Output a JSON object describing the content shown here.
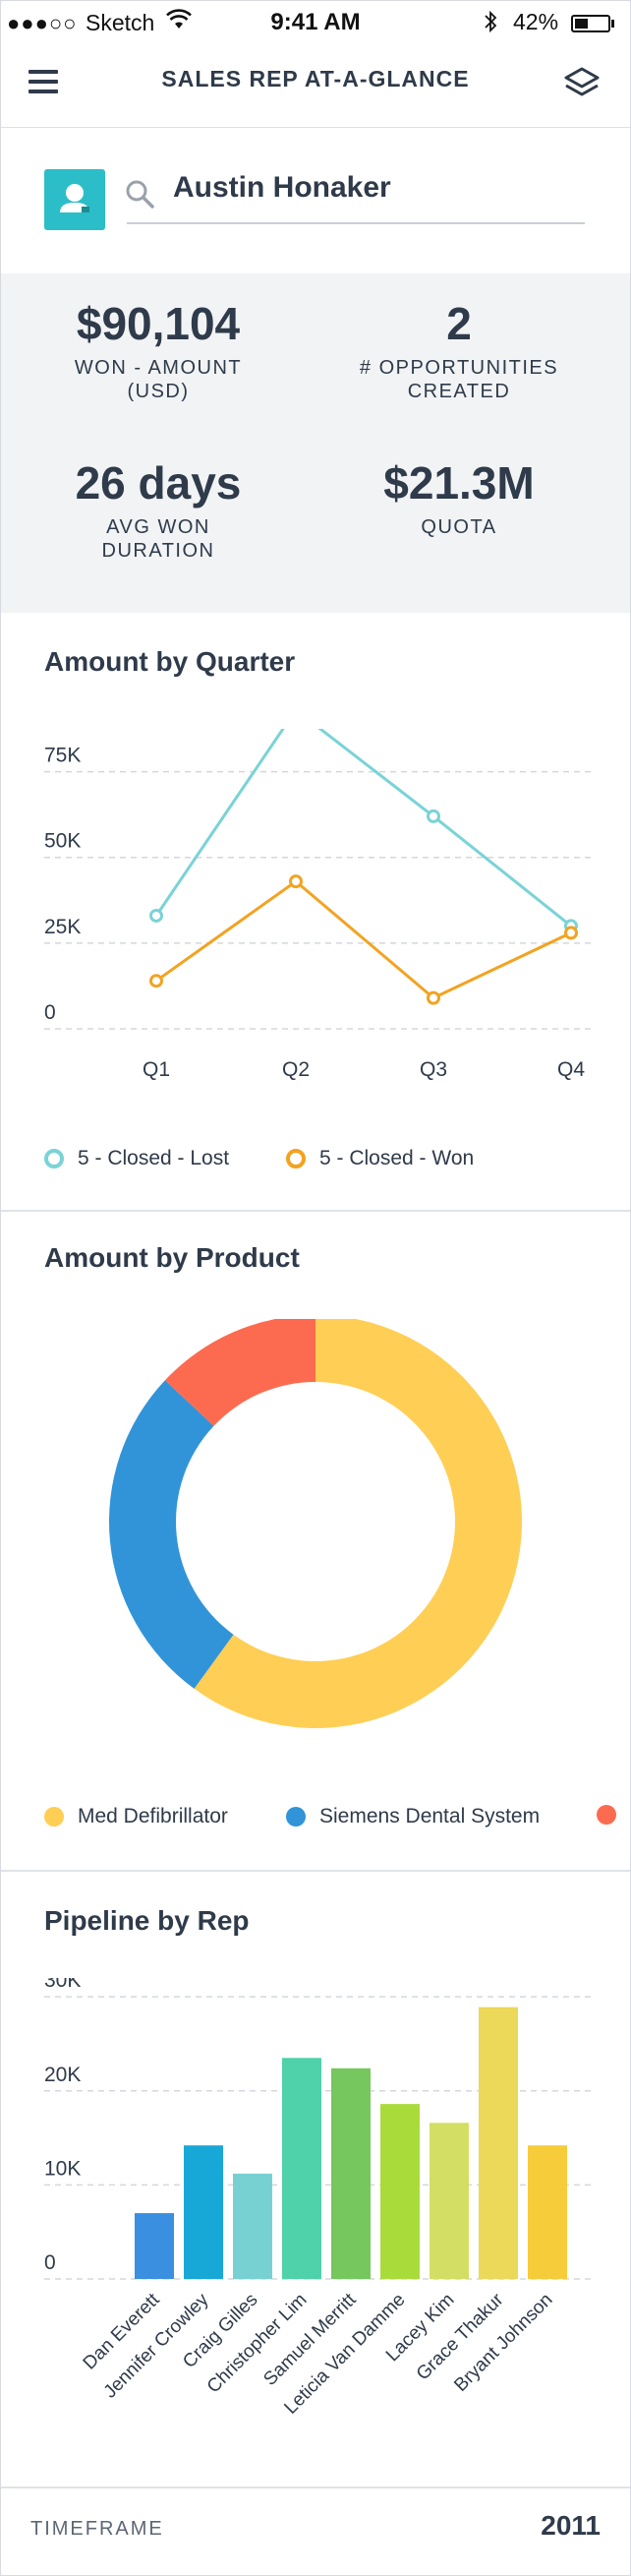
{
  "status_bar": {
    "signal": "●●●○○",
    "carrier": "Sketch",
    "time": "9:41 AM",
    "battery": "42%",
    "battery_level": 0.42
  },
  "nav": {
    "title": "SALES REP AT-A-GLANCE",
    "menu_icon": "hamburger-menu-icon",
    "layers_icon": "layers-icon"
  },
  "search": {
    "name": "Austin Honaker"
  },
  "metrics": [
    {
      "value": "$90,104",
      "label_line1": "WON - AMOUNT",
      "label_line2": "(USD)"
    },
    {
      "value": "2",
      "label_line1": "# OPPORTUNITIES",
      "label_line2": "CREATED"
    },
    {
      "value": "26 days",
      "label_line1": "AVG WON",
      "label_line2": "DURATION"
    },
    {
      "value": "$21.3M",
      "label_line1": "QUOTA",
      "label_line2": ""
    }
  ],
  "colors": {
    "teal": "#7ad3d6",
    "orange": "#f2a321",
    "yellow": "#ffce54",
    "blue": "#3194d8",
    "red": "#fc6b50"
  },
  "chart_data": [
    {
      "type": "line",
      "title": "Amount by Quarter",
      "categories": [
        "Q1",
        "Q2",
        "Q3",
        "Q4"
      ],
      "y_ticks": [
        "75K",
        "50K",
        "25K",
        "0"
      ],
      "ylim": [
        0,
        87500
      ],
      "grid": true,
      "series": [
        {
          "name": "5 - Closed - Lost",
          "values": [
            33000,
            93000,
            62000,
            30000
          ],
          "color": "#7ad3d6"
        },
        {
          "name": "5 - Closed - Won",
          "values": [
            14000,
            43000,
            9000,
            28000
          ],
          "color": "#f2a321"
        }
      ]
    },
    {
      "type": "pie",
      "title": "Amount by Product",
      "donut": true,
      "series": [
        {
          "name": "Med Defibrillator",
          "value": 60,
          "color": "#ffce54"
        },
        {
          "name": "Siemens Dental System",
          "value": 27,
          "color": "#3194d8"
        },
        {
          "name": "",
          "value": 13,
          "color": "#fc6b50"
        }
      ]
    },
    {
      "type": "bar",
      "title": "Pipeline by Rep",
      "categories": [
        "Dan Everett",
        "Jennifer Crowley",
        "Craig Gilles",
        "Christopher Lim",
        "Samuel Merritt",
        "Leticia Van Damme",
        "Lacey Kim",
        "Grace Thakur",
        "Bryant Johnson"
      ],
      "values": [
        7000,
        14200,
        11200,
        23500,
        22400,
        18600,
        16600,
        28900,
        14200
      ],
      "colors": [
        "#3b8fe0",
        "#17a8d8",
        "#77d1d3",
        "#4fd1aa",
        "#76c75d",
        "#a9dc3a",
        "#d2df64",
        "#ecd859",
        "#f7cc3a"
      ],
      "y_ticks": [
        "30K",
        "20K",
        "10K",
        "0"
      ],
      "ylim": [
        0,
        32000
      ],
      "grid": true
    }
  ],
  "footer": {
    "label": "TIMEFRAME",
    "year": "2011"
  }
}
